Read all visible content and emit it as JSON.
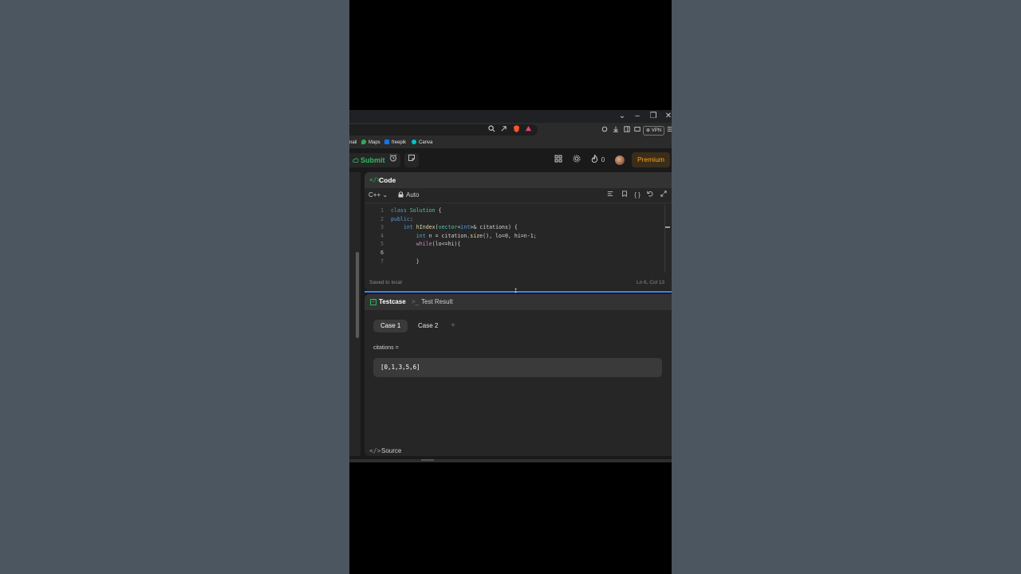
{
  "window": {
    "controls": [
      "⌄",
      "–",
      "❐",
      "✕"
    ]
  },
  "addressbar": {
    "vpn_label": "⊕ VPN"
  },
  "bookmarks": [
    {
      "label": "nail",
      "color": ""
    },
    {
      "label": "Maps",
      "color": "#34a853"
    },
    {
      "label": "freepik",
      "color": "#1273eb"
    },
    {
      "label": "Canva",
      "color": "#00c4cc"
    }
  ],
  "nav": {
    "submit_label": "Submit",
    "streak_count": "0",
    "premium_label": "Premium"
  },
  "code_panel": {
    "title": "Code",
    "language": "C++ ⌄",
    "mode": "Auto",
    "lines": [
      {
        "n": "1",
        "text": "class Solution {"
      },
      {
        "n": "2",
        "text": "public:"
      },
      {
        "n": "3",
        "text": "    int hIndex(vector<int>& citations) {"
      },
      {
        "n": "4",
        "text": "        int n = citation.size(), lo=0, hi=n-1;"
      },
      {
        "n": "5",
        "text": "        while(lo<=hi){"
      },
      {
        "n": "6",
        "text": ""
      },
      {
        "n": "7",
        "text": "        }"
      }
    ],
    "saved_status": "Saved to local",
    "cursor_position": "Ln 6, Col 13"
  },
  "test_panel": {
    "tab_testcase": "Testcase",
    "tab_result": "Test Result",
    "cases": [
      "Case 1",
      "Case 2"
    ],
    "add_case": "+",
    "param_label": "citations =",
    "param_value": "[0,1,3,5,6]",
    "source_label": "Source"
  },
  "colors": {
    "accent_green": "#2cbb5d",
    "premium_orange": "#ffa116",
    "divider_blue": "#3b82f6"
  }
}
